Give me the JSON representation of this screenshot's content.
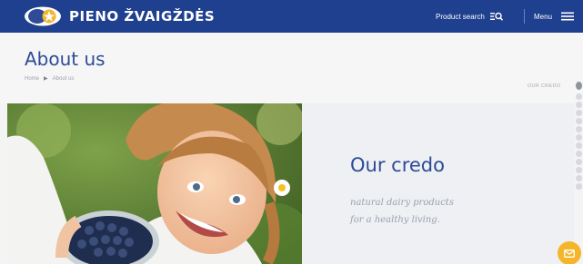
{
  "header": {
    "brand": "PIENO ŽVAIGŽDĖS",
    "product_search_label": "Product search",
    "menu_label": "Menu",
    "icons": [
      "logo-icon",
      "product-search-icon",
      "menu-icon"
    ],
    "bg_color": "#1f3f8f"
  },
  "page": {
    "title": "About us",
    "breadcrumb": [
      "Home",
      "About us"
    ],
    "section_label": "OUR CREDO"
  },
  "credo": {
    "title": "Our credo",
    "line1": "natural dairy products",
    "line2": "for a healthy living."
  },
  "colors": {
    "title_blue": "#2d4b96",
    "accent_yellow": "#f5b52b"
  },
  "section_nav": {
    "count": 10,
    "active_index": 0
  },
  "mail_icon": "mail-icon"
}
